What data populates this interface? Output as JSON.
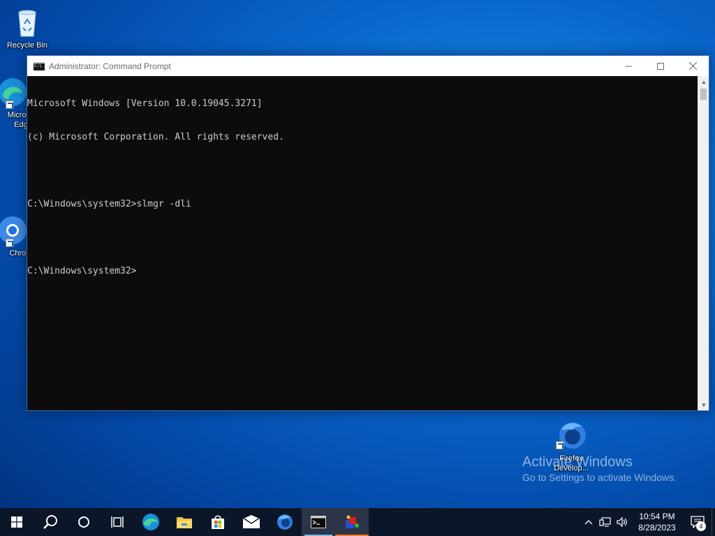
{
  "desktop": {
    "icons": [
      {
        "label": "Recycle Bin",
        "icon": "recycle-bin-icon"
      },
      {
        "label": "Microsoft Edge",
        "icon": "edge-icon"
      },
      {
        "label": "Chrome",
        "icon": "chrome-icon"
      },
      {
        "label": "Firefox Develop...",
        "icon": "firefox-developer-icon"
      }
    ]
  },
  "window": {
    "title": "Administrator: Command Prompt",
    "buttons": {
      "minimize": "minimize-icon",
      "maximize": "maximize-icon",
      "close": "close-icon"
    },
    "console_lines": [
      "Microsoft Windows [Version 10.0.19045.3271]",
      "(c) Microsoft Corporation. All rights reserved.",
      "",
      "C:\\Windows\\system32>slmgr -dli",
      "",
      "C:\\Windows\\system32>"
    ]
  },
  "watermark": {
    "title": "Activate Windows",
    "subtitle": "Go to Settings to activate Windows."
  },
  "taskbar": {
    "items": [
      {
        "name": "start-button",
        "icon": "windows-logo-icon"
      },
      {
        "name": "search-button",
        "icon": "search-icon"
      },
      {
        "name": "cortana-button",
        "icon": "cortana-icon"
      },
      {
        "name": "task-view-button",
        "icon": "task-view-icon"
      },
      {
        "name": "taskbar-edge",
        "icon": "edge-icon"
      },
      {
        "name": "taskbar-file-explorer",
        "icon": "folder-icon"
      },
      {
        "name": "taskbar-store",
        "icon": "store-icon"
      },
      {
        "name": "taskbar-mail",
        "icon": "mail-icon"
      },
      {
        "name": "taskbar-firefox",
        "icon": "firefox-developer-icon"
      },
      {
        "name": "taskbar-command-prompt",
        "icon": "cmd-icon"
      },
      {
        "name": "taskbar-app",
        "icon": "app-icon"
      }
    ],
    "tray": {
      "time": "10:54 PM",
      "date": "8/28/2023",
      "notification_count": "4"
    }
  },
  "colors": {
    "console_bg": "#0c0c0c",
    "console_text": "#cccccc",
    "taskbar_bg": "#0c1629",
    "desktop_accent": "#0a6ad0"
  }
}
